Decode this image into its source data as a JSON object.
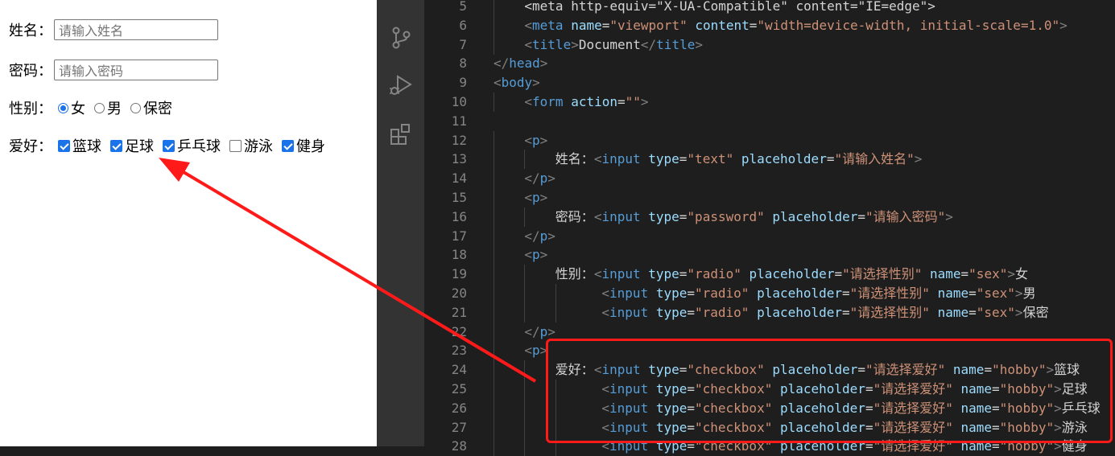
{
  "preview": {
    "name_label": "姓名：",
    "name_placeholder": "请输入姓名",
    "password_label": "密码：",
    "password_placeholder": "请输入密码",
    "sex_label": "性别：",
    "sex_options": [
      {
        "label": "女",
        "checked": true
      },
      {
        "label": "男",
        "checked": false
      },
      {
        "label": "保密",
        "checked": false
      }
    ],
    "hobby_label": "爱好：",
    "hobby_options": [
      {
        "label": "篮球",
        "checked": true
      },
      {
        "label": "足球",
        "checked": true
      },
      {
        "label": "乒乓球",
        "checked": true
      },
      {
        "label": "游泳",
        "checked": false
      },
      {
        "label": "健身",
        "checked": true
      }
    ]
  },
  "activity_icons": [
    "source-control-icon",
    "run-debug-icon",
    "extensions-icon"
  ],
  "editor": {
    "lines": [
      {
        "n": "5",
        "indent": 4,
        "tokens": [
          [
            "tx",
            "<meta http-equiv=\"X-UA-Compatible\" content=\"IE=edge\">"
          ]
        ]
      },
      {
        "n": "6",
        "indent": 4,
        "tokens": [
          [
            "br",
            "<"
          ],
          [
            "tag",
            "meta "
          ],
          [
            "at",
            "name"
          ],
          [
            "tx",
            "="
          ],
          [
            "st",
            "\"viewport\" "
          ],
          [
            "at",
            "content"
          ],
          [
            "tx",
            "="
          ],
          [
            "st",
            "\"width=device-width, initial-scale=1.0\""
          ],
          [
            "br",
            ">"
          ]
        ]
      },
      {
        "n": "7",
        "indent": 4,
        "tokens": [
          [
            "br",
            "<"
          ],
          [
            "tag",
            "title"
          ],
          [
            "br",
            ">"
          ],
          [
            "tx",
            "Document"
          ],
          [
            "br",
            "</"
          ],
          [
            "tag",
            "title"
          ],
          [
            "br",
            ">"
          ]
        ]
      },
      {
        "n": "8",
        "indent": 0,
        "tokens": [
          [
            "br",
            "</"
          ],
          [
            "tag",
            "head"
          ],
          [
            "br",
            ">"
          ]
        ]
      },
      {
        "n": "9",
        "indent": 0,
        "tokens": [
          [
            "br",
            "<"
          ],
          [
            "tag",
            "body"
          ],
          [
            "br",
            ">"
          ]
        ]
      },
      {
        "n": "10",
        "indent": 4,
        "tokens": [
          [
            "br",
            "<"
          ],
          [
            "tag",
            "form "
          ],
          [
            "at",
            "action"
          ],
          [
            "tx",
            "="
          ],
          [
            "st",
            "\"\""
          ],
          [
            "br",
            ">"
          ]
        ]
      },
      {
        "n": "11",
        "indent": 0,
        "tokens": []
      },
      {
        "n": "12",
        "indent": 4,
        "tokens": [
          [
            "br",
            "<"
          ],
          [
            "tag",
            "p"
          ],
          [
            "br",
            ">"
          ]
        ]
      },
      {
        "n": "13",
        "indent": 8,
        "tokens": [
          [
            "tx",
            "姓名："
          ],
          [
            "br",
            "<"
          ],
          [
            "tag",
            "input "
          ],
          [
            "at",
            "type"
          ],
          [
            "tx",
            "="
          ],
          [
            "st",
            "\"text\" "
          ],
          [
            "at",
            "placeholder"
          ],
          [
            "tx",
            "="
          ],
          [
            "st",
            "\"请输入姓名\""
          ],
          [
            "br",
            ">"
          ]
        ]
      },
      {
        "n": "14",
        "indent": 4,
        "tokens": [
          [
            "br",
            "</"
          ],
          [
            "tag",
            "p"
          ],
          [
            "br",
            ">"
          ]
        ]
      },
      {
        "n": "15",
        "indent": 4,
        "tokens": [
          [
            "br",
            "<"
          ],
          [
            "tag",
            "p"
          ],
          [
            "br",
            ">"
          ]
        ]
      },
      {
        "n": "16",
        "indent": 8,
        "tokens": [
          [
            "tx",
            "密码："
          ],
          [
            "br",
            "<"
          ],
          [
            "tag",
            "input "
          ],
          [
            "at",
            "type"
          ],
          [
            "tx",
            "="
          ],
          [
            "st",
            "\"password\" "
          ],
          [
            "at",
            "placeholder"
          ],
          [
            "tx",
            "="
          ],
          [
            "st",
            "\"请输入密码\""
          ],
          [
            "br",
            ">"
          ]
        ]
      },
      {
        "n": "17",
        "indent": 4,
        "tokens": [
          [
            "br",
            "</"
          ],
          [
            "tag",
            "p"
          ],
          [
            "br",
            ">"
          ]
        ]
      },
      {
        "n": "18",
        "indent": 4,
        "tokens": [
          [
            "br",
            "<"
          ],
          [
            "tag",
            "p"
          ],
          [
            "br",
            ">"
          ]
        ]
      },
      {
        "n": "19",
        "indent": 8,
        "tokens": [
          [
            "tx",
            "性别："
          ],
          [
            "br",
            "<"
          ],
          [
            "tag",
            "input "
          ],
          [
            "at",
            "type"
          ],
          [
            "tx",
            "="
          ],
          [
            "st",
            "\"radio\" "
          ],
          [
            "at",
            "placeholder"
          ],
          [
            "tx",
            "="
          ],
          [
            "st",
            "\"请选择性别\" "
          ],
          [
            "at",
            "name"
          ],
          [
            "tx",
            "="
          ],
          [
            "st",
            "\"sex\""
          ],
          [
            "br",
            ">"
          ],
          [
            "tx",
            "女"
          ]
        ]
      },
      {
        "n": "20",
        "indent": 14,
        "tokens": [
          [
            "br",
            "<"
          ],
          [
            "tag",
            "input "
          ],
          [
            "at",
            "type"
          ],
          [
            "tx",
            "="
          ],
          [
            "st",
            "\"radio\" "
          ],
          [
            "at",
            "placeholder"
          ],
          [
            "tx",
            "="
          ],
          [
            "st",
            "\"请选择性别\" "
          ],
          [
            "at",
            "name"
          ],
          [
            "tx",
            "="
          ],
          [
            "st",
            "\"sex\""
          ],
          [
            "br",
            ">"
          ],
          [
            "tx",
            "男"
          ]
        ]
      },
      {
        "n": "21",
        "indent": 14,
        "tokens": [
          [
            "br",
            "<"
          ],
          [
            "tag",
            "input "
          ],
          [
            "at",
            "type"
          ],
          [
            "tx",
            "="
          ],
          [
            "st",
            "\"radio\" "
          ],
          [
            "at",
            "placeholder"
          ],
          [
            "tx",
            "="
          ],
          [
            "st",
            "\"请选择性别\" "
          ],
          [
            "at",
            "name"
          ],
          [
            "tx",
            "="
          ],
          [
            "st",
            "\"sex\""
          ],
          [
            "br",
            ">"
          ],
          [
            "tx",
            "保密"
          ]
        ]
      },
      {
        "n": "22",
        "indent": 4,
        "tokens": [
          [
            "br",
            "</"
          ],
          [
            "tag",
            "p"
          ],
          [
            "br",
            ">"
          ]
        ]
      },
      {
        "n": "23",
        "indent": 4,
        "tokens": [
          [
            "br",
            "<"
          ],
          [
            "tag",
            "p"
          ],
          [
            "br",
            ">"
          ]
        ]
      },
      {
        "n": "24",
        "indent": 8,
        "tokens": [
          [
            "tx",
            "爱好："
          ],
          [
            "br",
            "<"
          ],
          [
            "tag",
            "input "
          ],
          [
            "at",
            "type"
          ],
          [
            "tx",
            "="
          ],
          [
            "st",
            "\"checkbox\" "
          ],
          [
            "at",
            "placeholder"
          ],
          [
            "tx",
            "="
          ],
          [
            "st",
            "\"请选择爱好\" "
          ],
          [
            "at",
            "name"
          ],
          [
            "tx",
            "="
          ],
          [
            "st",
            "\"hobby\""
          ],
          [
            "br",
            ">"
          ],
          [
            "tx",
            "篮球"
          ]
        ]
      },
      {
        "n": "25",
        "indent": 14,
        "tokens": [
          [
            "br",
            "<"
          ],
          [
            "tag",
            "input "
          ],
          [
            "at",
            "type"
          ],
          [
            "tx",
            "="
          ],
          [
            "st",
            "\"checkbox\" "
          ],
          [
            "at",
            "placeholder"
          ],
          [
            "tx",
            "="
          ],
          [
            "st",
            "\"请选择爱好\" "
          ],
          [
            "at",
            "name"
          ],
          [
            "tx",
            "="
          ],
          [
            "st",
            "\"hobby\""
          ],
          [
            "br",
            ">"
          ],
          [
            "tx",
            "足球"
          ]
        ]
      },
      {
        "n": "26",
        "indent": 14,
        "tokens": [
          [
            "br",
            "<"
          ],
          [
            "tag",
            "input "
          ],
          [
            "at",
            "type"
          ],
          [
            "tx",
            "="
          ],
          [
            "st",
            "\"checkbox\" "
          ],
          [
            "at",
            "placeholder"
          ],
          [
            "tx",
            "="
          ],
          [
            "st",
            "\"请选择爱好\" "
          ],
          [
            "at",
            "name"
          ],
          [
            "tx",
            "="
          ],
          [
            "st",
            "\"hobby\""
          ],
          [
            "br",
            ">"
          ],
          [
            "tx",
            "乒乓球"
          ]
        ]
      },
      {
        "n": "27",
        "indent": 14,
        "tokens": [
          [
            "br",
            "<"
          ],
          [
            "tag",
            "input "
          ],
          [
            "at",
            "type"
          ],
          [
            "tx",
            "="
          ],
          [
            "st",
            "\"checkbox\" "
          ],
          [
            "at",
            "placeholder"
          ],
          [
            "tx",
            "="
          ],
          [
            "st",
            "\"请选择爱好\" "
          ],
          [
            "at",
            "name"
          ],
          [
            "tx",
            "="
          ],
          [
            "st",
            "\"hobby\""
          ],
          [
            "br",
            ">"
          ],
          [
            "tx",
            "游泳"
          ]
        ]
      },
      {
        "n": "28",
        "indent": 14,
        "tokens": [
          [
            "br",
            "<"
          ],
          [
            "tag",
            "input "
          ],
          [
            "at",
            "type"
          ],
          [
            "tx",
            "="
          ],
          [
            "st",
            "\"checkbox\" "
          ],
          [
            "at",
            "placeholder"
          ],
          [
            "tx",
            "="
          ],
          [
            "st",
            "\"请选择爱好\" "
          ],
          [
            "at",
            "name"
          ],
          [
            "tx",
            "="
          ],
          [
            "st",
            "\"hobby\""
          ],
          [
            "br",
            ">"
          ],
          [
            "tx",
            "健身"
          ]
        ]
      }
    ]
  },
  "colors": {
    "highlight": "#ff1a1a",
    "arrow": "#ff1a1a",
    "checked": "#1a73e8"
  }
}
